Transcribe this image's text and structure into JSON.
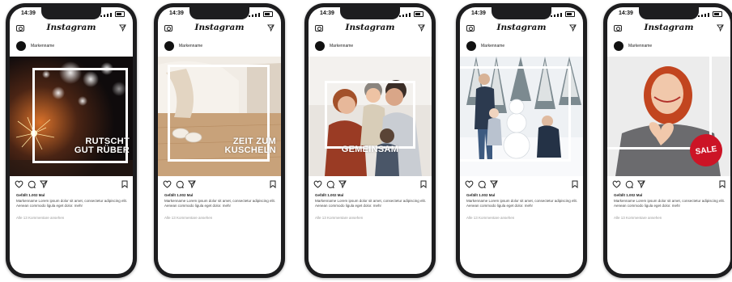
{
  "status_time": "14:39",
  "app_name": "Instagram",
  "phones": [
    {
      "username": "Markenname",
      "post_text_lines": [
        "RUTSCHT",
        "GUT RÜBER"
      ],
      "likes": "Gefällt 1.002 Mal",
      "caption": "Markenname Lorem ipsum dolor sit amet, consectetur adipiscing elit. Aenean commodo ligula eget dolor. mehr",
      "comments": "Alle 13 Kommentare ansehen"
    },
    {
      "username": "Markenname",
      "post_text_lines": [
        "ZEIT ZUM",
        "KUSCHELN"
      ],
      "likes": "Gefällt 1.002 Mal",
      "caption": "Markenname Lorem ipsum dolor sit amet, consectetur adipiscing elit. Aenean commodo ligula eget dolor. mehr",
      "comments": "Alle 13 Kommentare ansehen"
    },
    {
      "username": "Markenname",
      "post_text_lines": [
        "GEMEINSAM"
      ],
      "likes": "Gefällt 1.002 Mal",
      "caption": "Markenname Lorem ipsum dolor sit amet, consectetur adipiscing elit. Aenean commodo ligula eget dolor. mehr",
      "comments": "Alle 13 Kommentare ansehen"
    },
    {
      "username": "Markenname",
      "post_text_lines": [],
      "likes": "Gefällt 1.002 Mal",
      "caption": "Markenname Lorem ipsum dolor sit amet, consectetur adipiscing elit. Aenean commodo ligula eget dolor. mehr",
      "comments": "Alle 13 Kommentare ansehen"
    },
    {
      "username": "Markenname",
      "post_text_lines": [],
      "badge": "SALE",
      "likes": "Gefällt 1.002 Mal",
      "caption": "Markenname Lorem ipsum dolor sit amet, consectetur adipiscing elit. Aenean commodo ligula eget dolor. mehr",
      "comments": "Alle 13 Kommentare ansehen"
    }
  ],
  "colors": {
    "phone_body": "#1d1d1f",
    "sale_badge": "#cc1426",
    "frame": "#ffffff"
  },
  "icons": [
    "camera-icon",
    "send-icon",
    "heart-icon",
    "comment-icon",
    "share-icon",
    "bookmark-icon"
  ]
}
